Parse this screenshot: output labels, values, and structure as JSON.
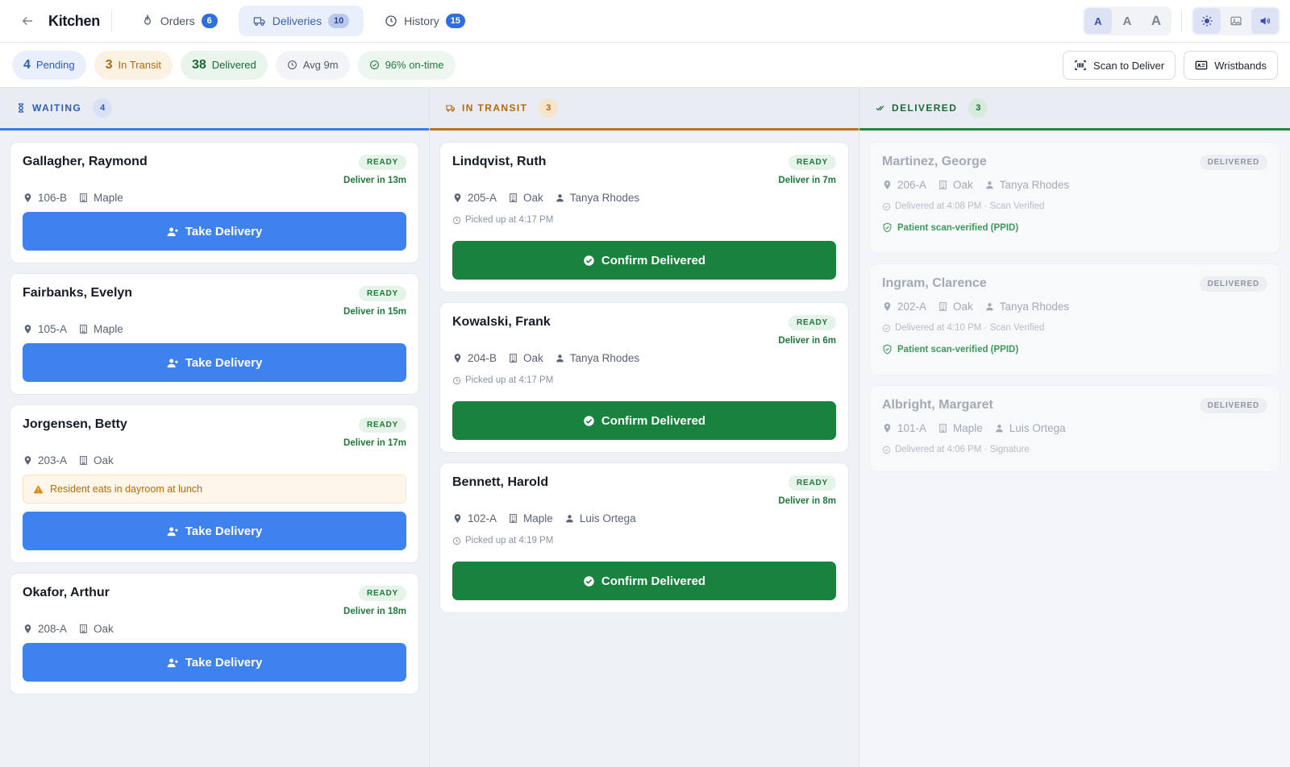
{
  "nav": {
    "brand": "Kitchen",
    "tabs": [
      {
        "label": "Orders",
        "count": "6"
      },
      {
        "label": "Deliveries",
        "count": "10"
      },
      {
        "label": "History",
        "count": "15"
      }
    ],
    "font_sizes": [
      "A",
      "A",
      "A"
    ]
  },
  "stats": {
    "pending_count": "4",
    "pending_label": "Pending",
    "transit_count": "3",
    "transit_label": "In Transit",
    "delivered_count": "38",
    "delivered_label": "Delivered",
    "avg": "Avg 9m",
    "ontime": "96% on-time",
    "scan_label": "Scan to Deliver",
    "wristbands_label": "Wristbands"
  },
  "columns": {
    "waiting": {
      "title": "WAITING",
      "count": "4"
    },
    "transit": {
      "title": "IN TRANSIT",
      "count": "3"
    },
    "delivered": {
      "title": "DELIVERED",
      "count": "3"
    }
  },
  "waiting": [
    {
      "name": "Gallagher, Raymond",
      "badge": "READY",
      "due": "Deliver in 13m",
      "room": "106-B",
      "wing": "Maple",
      "action": "Take Delivery"
    },
    {
      "name": "Fairbanks, Evelyn",
      "badge": "READY",
      "due": "Deliver in 15m",
      "room": "105-A",
      "wing": "Maple",
      "action": "Take Delivery"
    },
    {
      "name": "Jorgensen, Betty",
      "badge": "READY",
      "due": "Deliver in 17m",
      "room": "203-A",
      "wing": "Oak",
      "note": "Resident eats in dayroom at lunch",
      "action": "Take Delivery"
    },
    {
      "name": "Okafor, Arthur",
      "badge": "READY",
      "due": "Deliver in 18m",
      "room": "208-A",
      "wing": "Oak",
      "action": "Take Delivery"
    }
  ],
  "transit": [
    {
      "name": "Lindqvist, Ruth",
      "badge": "READY",
      "due": "Deliver in 7m",
      "room": "205-A",
      "wing": "Oak",
      "staff": "Tanya Rhodes",
      "picked": "Picked up at 4:17 PM",
      "action": "Confirm Delivered"
    },
    {
      "name": "Kowalski, Frank",
      "badge": "READY",
      "due": "Deliver in 6m",
      "room": "204-B",
      "wing": "Oak",
      "staff": "Tanya Rhodes",
      "picked": "Picked up at 4:17 PM",
      "action": "Confirm Delivered"
    },
    {
      "name": "Bennett, Harold",
      "badge": "READY",
      "due": "Deliver in 8m",
      "room": "102-A",
      "wing": "Maple",
      "staff": "Luis Ortega",
      "picked": "Picked up at 4:19 PM",
      "action": "Confirm Delivered"
    }
  ],
  "delivered": [
    {
      "name": "Martinez, George",
      "badge": "DELIVERED",
      "room": "206-A",
      "wing": "Oak",
      "staff": "Tanya Rhodes",
      "info": "Delivered at 4:08 PM · Scan Verified",
      "verified": "Patient scan-verified (PPID)"
    },
    {
      "name": "Ingram, Clarence",
      "badge": "DELIVERED",
      "room": "202-A",
      "wing": "Oak",
      "staff": "Tanya Rhodes",
      "info": "Delivered at 4:10 PM · Scan Verified",
      "verified": "Patient scan-verified (PPID)"
    },
    {
      "name": "Albright, Margaret",
      "badge": "DELIVERED",
      "room": "101-A",
      "wing": "Maple",
      "staff": "Luis Ortega",
      "info": "Delivered at 4:06 PM · Signature"
    }
  ]
}
